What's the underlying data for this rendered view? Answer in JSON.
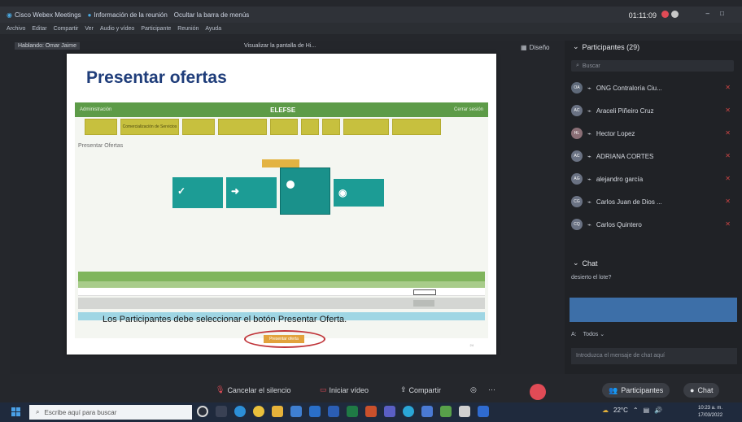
{
  "titlebar": {
    "app": "Cisco Webex Meetings",
    "info": "Información de la reunión",
    "hide_menu": "Ocultar la barra de menús",
    "clock": "01:11:09"
  },
  "menubar": [
    "Archivo",
    "Editar",
    "Compartir",
    "Ver",
    "Audio y vídeo",
    "Participante",
    "Reunión",
    "Ayuda"
  ],
  "stage": {
    "speaker": "Hablando: Omar Jaime",
    "share": "Visualizar la pantalla de Hi...",
    "layout": "Diseño"
  },
  "slide": {
    "title": "Presentar ofertas",
    "screen_brand": "ELEFSE",
    "screen_left": "Administración",
    "screen_right": "Cerrar sesión",
    "chips": [
      "",
      "Comercialización de Servicios",
      "",
      "",
      "",
      "",
      "",
      "",
      ""
    ],
    "subtitle": "Presentar Ofertas",
    "flow_label": "",
    "table_head": "",
    "present_button": "Presentar oferta",
    "caption": "Los Participantes debe seleccionar el botón Presentar Oferta.",
    "page": "24"
  },
  "panel": {
    "participants_title": "Participantes (29)",
    "search_placeholder": "Buscar",
    "participants": [
      {
        "initials": "OA",
        "name": "ONG Contraloría Ciu...",
        "color": "#5f6a7a"
      },
      {
        "initials": "AC",
        "name": "Araceli Piñeiro Cruz",
        "color": "#6a7283"
      },
      {
        "initials": "HL",
        "name": "Hector Lopez",
        "color": "#8a6f76"
      },
      {
        "initials": "AC",
        "name": "ADRIANA CORTES",
        "color": "#6a7283"
      },
      {
        "initials": "AG",
        "name": "alejandro garcía",
        "color": "#6a7283"
      },
      {
        "initials": "CG",
        "name": "Carlos Juan de Dios ...",
        "color": "#6a7283"
      },
      {
        "initials": "CQ",
        "name": "Carlos Quintero",
        "color": "#6a7283"
      }
    ],
    "chat_title": "Chat",
    "chat_message": "desierto el lote?",
    "chat_to": "A:",
    "chat_to_value": "Todos",
    "chat_placeholder": "Introduzca el mensaje de chat aquí"
  },
  "controls": {
    "mute": "Cancelar el silencio",
    "video": "Iniciar vídeo",
    "share": "Compartir",
    "participants": "Participantes",
    "chat": "Chat"
  },
  "taskbar": {
    "search": "Escribe aquí para buscar",
    "temp": "22°C",
    "time": "10:23 a. m.",
    "date": "17/03/2022"
  }
}
